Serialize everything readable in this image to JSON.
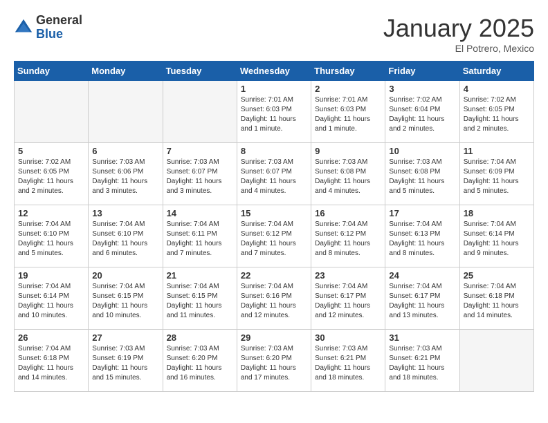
{
  "header": {
    "logo_general": "General",
    "logo_blue": "Blue",
    "month_title": "January 2025",
    "location": "El Potrero, Mexico"
  },
  "weekdays": [
    "Sunday",
    "Monday",
    "Tuesday",
    "Wednesday",
    "Thursday",
    "Friday",
    "Saturday"
  ],
  "weeks": [
    [
      {
        "day": "",
        "info": ""
      },
      {
        "day": "",
        "info": ""
      },
      {
        "day": "",
        "info": ""
      },
      {
        "day": "1",
        "info": "Sunrise: 7:01 AM\nSunset: 6:03 PM\nDaylight: 11 hours\nand 1 minute."
      },
      {
        "day": "2",
        "info": "Sunrise: 7:01 AM\nSunset: 6:03 PM\nDaylight: 11 hours\nand 1 minute."
      },
      {
        "day": "3",
        "info": "Sunrise: 7:02 AM\nSunset: 6:04 PM\nDaylight: 11 hours\nand 2 minutes."
      },
      {
        "day": "4",
        "info": "Sunrise: 7:02 AM\nSunset: 6:05 PM\nDaylight: 11 hours\nand 2 minutes."
      }
    ],
    [
      {
        "day": "5",
        "info": "Sunrise: 7:02 AM\nSunset: 6:05 PM\nDaylight: 11 hours\nand 2 minutes."
      },
      {
        "day": "6",
        "info": "Sunrise: 7:03 AM\nSunset: 6:06 PM\nDaylight: 11 hours\nand 3 minutes."
      },
      {
        "day": "7",
        "info": "Sunrise: 7:03 AM\nSunset: 6:07 PM\nDaylight: 11 hours\nand 3 minutes."
      },
      {
        "day": "8",
        "info": "Sunrise: 7:03 AM\nSunset: 6:07 PM\nDaylight: 11 hours\nand 4 minutes."
      },
      {
        "day": "9",
        "info": "Sunrise: 7:03 AM\nSunset: 6:08 PM\nDaylight: 11 hours\nand 4 minutes."
      },
      {
        "day": "10",
        "info": "Sunrise: 7:03 AM\nSunset: 6:08 PM\nDaylight: 11 hours\nand 5 minutes."
      },
      {
        "day": "11",
        "info": "Sunrise: 7:04 AM\nSunset: 6:09 PM\nDaylight: 11 hours\nand 5 minutes."
      }
    ],
    [
      {
        "day": "12",
        "info": "Sunrise: 7:04 AM\nSunset: 6:10 PM\nDaylight: 11 hours\nand 5 minutes."
      },
      {
        "day": "13",
        "info": "Sunrise: 7:04 AM\nSunset: 6:10 PM\nDaylight: 11 hours\nand 6 minutes."
      },
      {
        "day": "14",
        "info": "Sunrise: 7:04 AM\nSunset: 6:11 PM\nDaylight: 11 hours\nand 7 minutes."
      },
      {
        "day": "15",
        "info": "Sunrise: 7:04 AM\nSunset: 6:12 PM\nDaylight: 11 hours\nand 7 minutes."
      },
      {
        "day": "16",
        "info": "Sunrise: 7:04 AM\nSunset: 6:12 PM\nDaylight: 11 hours\nand 8 minutes."
      },
      {
        "day": "17",
        "info": "Sunrise: 7:04 AM\nSunset: 6:13 PM\nDaylight: 11 hours\nand 8 minutes."
      },
      {
        "day": "18",
        "info": "Sunrise: 7:04 AM\nSunset: 6:14 PM\nDaylight: 11 hours\nand 9 minutes."
      }
    ],
    [
      {
        "day": "19",
        "info": "Sunrise: 7:04 AM\nSunset: 6:14 PM\nDaylight: 11 hours\nand 10 minutes."
      },
      {
        "day": "20",
        "info": "Sunrise: 7:04 AM\nSunset: 6:15 PM\nDaylight: 11 hours\nand 10 minutes."
      },
      {
        "day": "21",
        "info": "Sunrise: 7:04 AM\nSunset: 6:15 PM\nDaylight: 11 hours\nand 11 minutes."
      },
      {
        "day": "22",
        "info": "Sunrise: 7:04 AM\nSunset: 6:16 PM\nDaylight: 11 hours\nand 12 minutes."
      },
      {
        "day": "23",
        "info": "Sunrise: 7:04 AM\nSunset: 6:17 PM\nDaylight: 11 hours\nand 12 minutes."
      },
      {
        "day": "24",
        "info": "Sunrise: 7:04 AM\nSunset: 6:17 PM\nDaylight: 11 hours\nand 13 minutes."
      },
      {
        "day": "25",
        "info": "Sunrise: 7:04 AM\nSunset: 6:18 PM\nDaylight: 11 hours\nand 14 minutes."
      }
    ],
    [
      {
        "day": "26",
        "info": "Sunrise: 7:04 AM\nSunset: 6:18 PM\nDaylight: 11 hours\nand 14 minutes."
      },
      {
        "day": "27",
        "info": "Sunrise: 7:03 AM\nSunset: 6:19 PM\nDaylight: 11 hours\nand 15 minutes."
      },
      {
        "day": "28",
        "info": "Sunrise: 7:03 AM\nSunset: 6:20 PM\nDaylight: 11 hours\nand 16 minutes."
      },
      {
        "day": "29",
        "info": "Sunrise: 7:03 AM\nSunset: 6:20 PM\nDaylight: 11 hours\nand 17 minutes."
      },
      {
        "day": "30",
        "info": "Sunrise: 7:03 AM\nSunset: 6:21 PM\nDaylight: 11 hours\nand 18 minutes."
      },
      {
        "day": "31",
        "info": "Sunrise: 7:03 AM\nSunset: 6:21 PM\nDaylight: 11 hours\nand 18 minutes."
      },
      {
        "day": "",
        "info": ""
      }
    ]
  ]
}
